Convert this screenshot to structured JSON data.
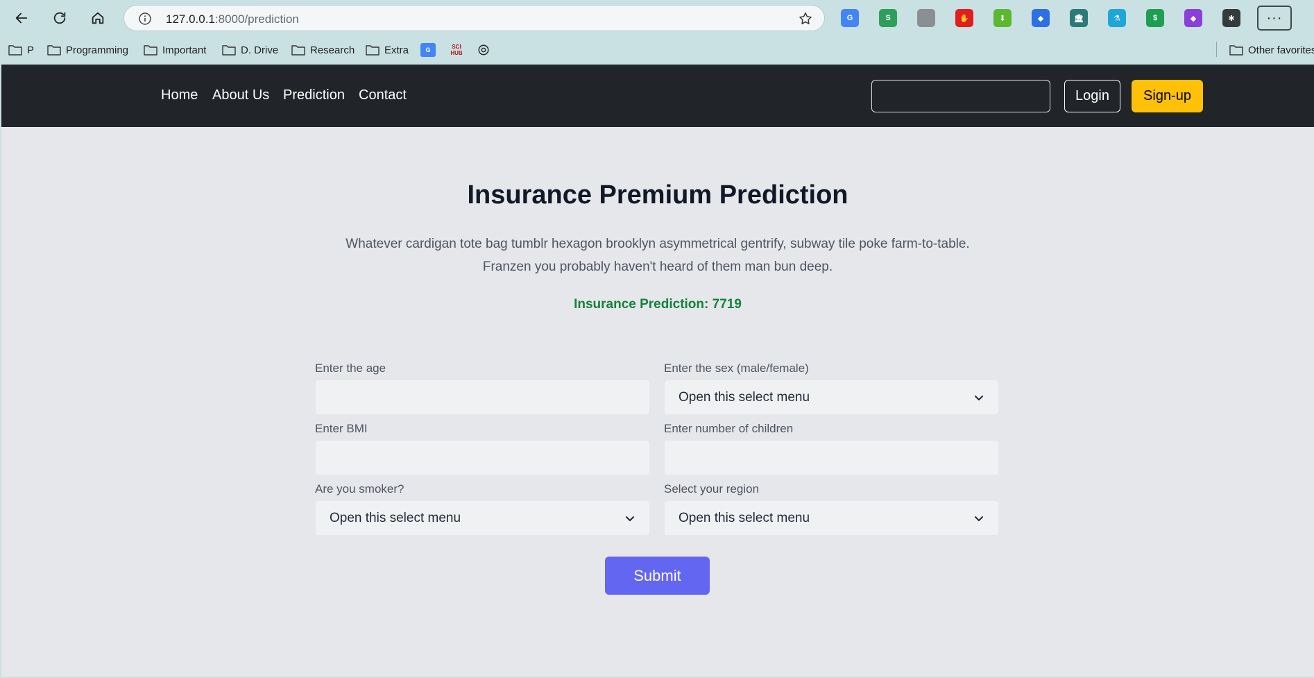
{
  "browser": {
    "url_host": "127.0.0.1",
    "url_path": ":8000/prediction",
    "more_label": "···",
    "extensions": [
      {
        "name": "google-translate-icon",
        "color": "#4285f4",
        "glyph": "G"
      },
      {
        "name": "sheets-extension-icon",
        "color": "#2e9e5b",
        "glyph": "S"
      },
      {
        "name": "document-icon",
        "color": "#8a8f94",
        "glyph": ""
      },
      {
        "name": "adblock-icon",
        "color": "#e01e1e",
        "glyph": "✋"
      },
      {
        "name": "download-arrow-icon",
        "color": "#5cb82f",
        "glyph": "⬇"
      },
      {
        "name": "layer-icon",
        "color": "#2f6fe4",
        "glyph": "◆"
      },
      {
        "name": "bank-icon",
        "color": "#2b7a78",
        "glyph": "🏛"
      },
      {
        "name": "lab-icon",
        "color": "#1ea7d6",
        "glyph": "⚗"
      },
      {
        "name": "calendar-icon",
        "color": "#1d9e52",
        "glyph": "$"
      },
      {
        "name": "purple-app-icon",
        "color": "#8b3fd9",
        "glyph": "◆"
      },
      {
        "name": "puzzle-icon",
        "color": "#333b3d",
        "glyph": "✱"
      }
    ]
  },
  "bookmarks": {
    "items": [
      "P",
      "Programming",
      "Important",
      "D. Drive",
      "Research",
      "Extra"
    ],
    "sci_hub": "SCI HUB",
    "other": "Other favorites"
  },
  "nav": {
    "home": "Home",
    "about": "About Us",
    "prediction": "Prediction",
    "contact": "Contact",
    "login": "Login",
    "signup": "Sign-up",
    "search_value": ""
  },
  "main": {
    "title": "Insurance Premium Prediction",
    "description_line1": "Whatever cardigan tote bag tumblr hexagon brooklyn asymmetrical gentrify, subway tile poke farm-to-table.",
    "description_line2": "Franzen you probably haven't heard of them man bun deep.",
    "prediction": "Insurance Prediction: 7719"
  },
  "form": {
    "age_label": "Enter the age",
    "age_value": "",
    "sex_label": "Enter the sex (male/female)",
    "sex_value": "Open this select menu",
    "bmi_label": "Enter BMI",
    "bmi_value": "",
    "children_label": "Enter number of children",
    "children_value": "",
    "smoker_label": "Are you smoker?",
    "smoker_value": "Open this select menu",
    "region_label": "Select your region",
    "region_value": "Open this select menu",
    "submit": "Submit"
  },
  "colors": {
    "header_bg": "#212529",
    "signup_bg": "#ffc107",
    "submit_bg": "#6366f1",
    "prediction_text": "#15803d"
  }
}
